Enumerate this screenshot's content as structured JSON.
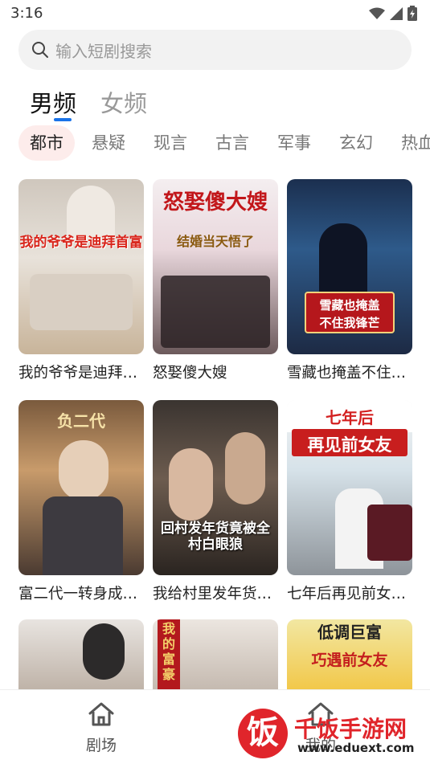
{
  "status": {
    "time": "3:16"
  },
  "search": {
    "placeholder": "输入短剧搜索",
    "icon": "search-icon"
  },
  "gender_tabs": [
    {
      "label": "男频",
      "active": true
    },
    {
      "label": "女频",
      "active": false
    }
  ],
  "categories": [
    {
      "label": "都市",
      "active": true
    },
    {
      "label": "悬疑",
      "active": false
    },
    {
      "label": "现言",
      "active": false
    },
    {
      "label": "古言",
      "active": false
    },
    {
      "label": "军事",
      "active": false
    },
    {
      "label": "玄幻",
      "active": false
    },
    {
      "label": "热血",
      "active": false
    }
  ],
  "dramas": [
    {
      "title": "我的爷爷是迪拜…",
      "cover_text": "我的爷爷是迪拜首富"
    },
    {
      "title": "怒娶傻大嫂",
      "cover_text": "怒娶傻大嫂",
      "cover_sub": "结婚当天悟了"
    },
    {
      "title": "雪藏也掩盖不住…",
      "cover_text": "雪藏也掩盖",
      "cover_sub": "不住我锋芒"
    },
    {
      "title": "富二代一转身成…",
      "cover_text": "负二代"
    },
    {
      "title": "我给村里发年货…",
      "cover_text": "回村发年货竟被全村白眼狼"
    },
    {
      "title": "七年后再见前女…",
      "cover_text": "七年后",
      "cover_sub": "再见前女友"
    },
    {
      "cover_text": ""
    },
    {
      "cover_text": "我的富豪"
    },
    {
      "cover_text": "低调巨富",
      "cover_sub": "巧遇前女友"
    }
  ],
  "bottom_nav": [
    {
      "label": "剧场",
      "icon": "home-icon"
    },
    {
      "label": "我的",
      "icon": "home-icon"
    }
  ],
  "watermark": {
    "brand": "千饭手游网",
    "url": "www.eduext.com",
    "logo_char": "饭"
  },
  "colors": {
    "accent": "#1a73e8",
    "active_chip_bg": "#fdeceb",
    "watermark_red": "#e0252b"
  }
}
